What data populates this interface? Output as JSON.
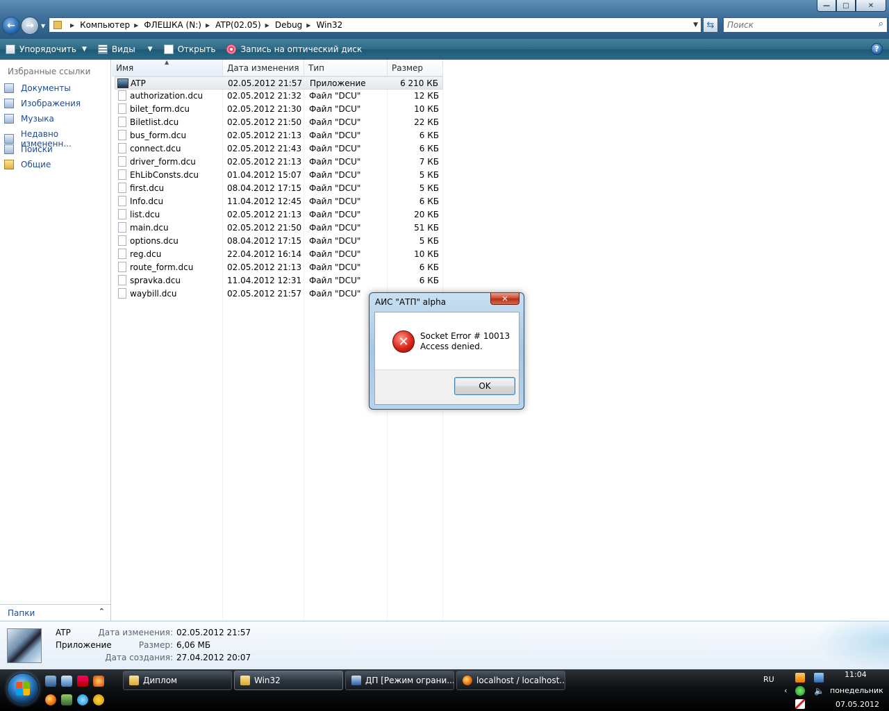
{
  "window": {
    "breadcrumb": [
      "Компьютер",
      "ФЛЕШКА (N:)",
      "ATP(02.05)",
      "Debug",
      "Win32"
    ],
    "search_placeholder": "Поиск",
    "buttons": {
      "minimize": "—",
      "maximize": "□",
      "close": "✕"
    }
  },
  "toolbar": {
    "organize": "Упорядочить",
    "views": "Виды",
    "open": "Открыть",
    "burn": "Запись на оптический диск",
    "help": "?"
  },
  "navpane": {
    "heading": "Избранные ссылки",
    "links": [
      {
        "label": "Документы",
        "icon": "documents-icon"
      },
      {
        "label": "Изображения",
        "icon": "pictures-icon"
      },
      {
        "label": "Музыка",
        "icon": "music-icon"
      },
      {
        "label": "Недавно измененн...",
        "icon": "recent-icon"
      },
      {
        "label": "Поиски",
        "icon": "searches-icon"
      },
      {
        "label": "Общие",
        "icon": "public-folder-icon"
      }
    ],
    "folders_label": "Папки",
    "folders_chevron": "⌃"
  },
  "filelist": {
    "columns": {
      "name": "Имя",
      "date": "Дата изменения",
      "type": "Тип",
      "size": "Размер"
    },
    "files": [
      {
        "name": "ATP",
        "date": "02.05.2012 21:57",
        "type": "Приложение",
        "size": "6 210 КБ"
      },
      {
        "name": "authorization.dcu",
        "date": "02.05.2012 21:32",
        "type": "Файл \"DCU\"",
        "size": "12 КБ"
      },
      {
        "name": "bilet_form.dcu",
        "date": "02.05.2012 21:30",
        "type": "Файл \"DCU\"",
        "size": "10 КБ"
      },
      {
        "name": "Biletlist.dcu",
        "date": "02.05.2012 21:50",
        "type": "Файл \"DCU\"",
        "size": "22 КБ"
      },
      {
        "name": "bus_form.dcu",
        "date": "02.05.2012 21:13",
        "type": "Файл \"DCU\"",
        "size": "6 КБ"
      },
      {
        "name": "connect.dcu",
        "date": "02.05.2012 21:43",
        "type": "Файл \"DCU\"",
        "size": "6 КБ"
      },
      {
        "name": "driver_form.dcu",
        "date": "02.05.2012 21:13",
        "type": "Файл \"DCU\"",
        "size": "7 КБ"
      },
      {
        "name": "EhLibConsts.dcu",
        "date": "01.04.2012 15:07",
        "type": "Файл \"DCU\"",
        "size": "5 КБ"
      },
      {
        "name": "first.dcu",
        "date": "08.04.2012 17:15",
        "type": "Файл \"DCU\"",
        "size": "5 КБ"
      },
      {
        "name": "Info.dcu",
        "date": "11.04.2012 12:45",
        "type": "Файл \"DCU\"",
        "size": "6 КБ"
      },
      {
        "name": "list.dcu",
        "date": "02.05.2012 21:13",
        "type": "Файл \"DCU\"",
        "size": "20 КБ"
      },
      {
        "name": "main.dcu",
        "date": "02.05.2012 21:50",
        "type": "Файл \"DCU\"",
        "size": "51 КБ"
      },
      {
        "name": "options.dcu",
        "date": "08.04.2012 17:15",
        "type": "Файл \"DCU\"",
        "size": "5 КБ"
      },
      {
        "name": "reg.dcu",
        "date": "22.04.2012 16:14",
        "type": "Файл \"DCU\"",
        "size": "10 КБ"
      },
      {
        "name": "route_form.dcu",
        "date": "02.05.2012 21:13",
        "type": "Файл \"DCU\"",
        "size": "6 КБ"
      },
      {
        "name": "spravka.dcu",
        "date": "11.04.2012 12:31",
        "type": "Файл \"DCU\"",
        "size": "6 КБ"
      },
      {
        "name": "waybill.dcu",
        "date": "02.05.2012 21:57",
        "type": "Файл \"DCU\"",
        "size": ""
      }
    ]
  },
  "details": {
    "name": "ATP",
    "kind": "Приложение",
    "modified_label": "Дата изменения:",
    "modified_value": "02.05.2012 21:57",
    "size_label": "Размер:",
    "size_value": "6,06 МБ",
    "created_label": "Дата создания:",
    "created_value": "27.04.2012 20:07"
  },
  "dialog": {
    "title": "АИС \"АТП\" alpha",
    "close": "✕",
    "message_line1": "Socket Error # 10013",
    "message_line2": "Access denied.",
    "ok": "OK"
  },
  "taskbar": {
    "items": [
      {
        "label": "Диплом",
        "icon": "folder-icon"
      },
      {
        "label": "Win32",
        "icon": "folder-icon"
      },
      {
        "label": "ДП [Режим ограни...",
        "icon": "word-icon"
      },
      {
        "label": "localhost / localhost...",
        "icon": "firefox-icon"
      }
    ],
    "language": "RU",
    "time": "11:04",
    "day": "понедельник",
    "date": "07.05.2012"
  }
}
